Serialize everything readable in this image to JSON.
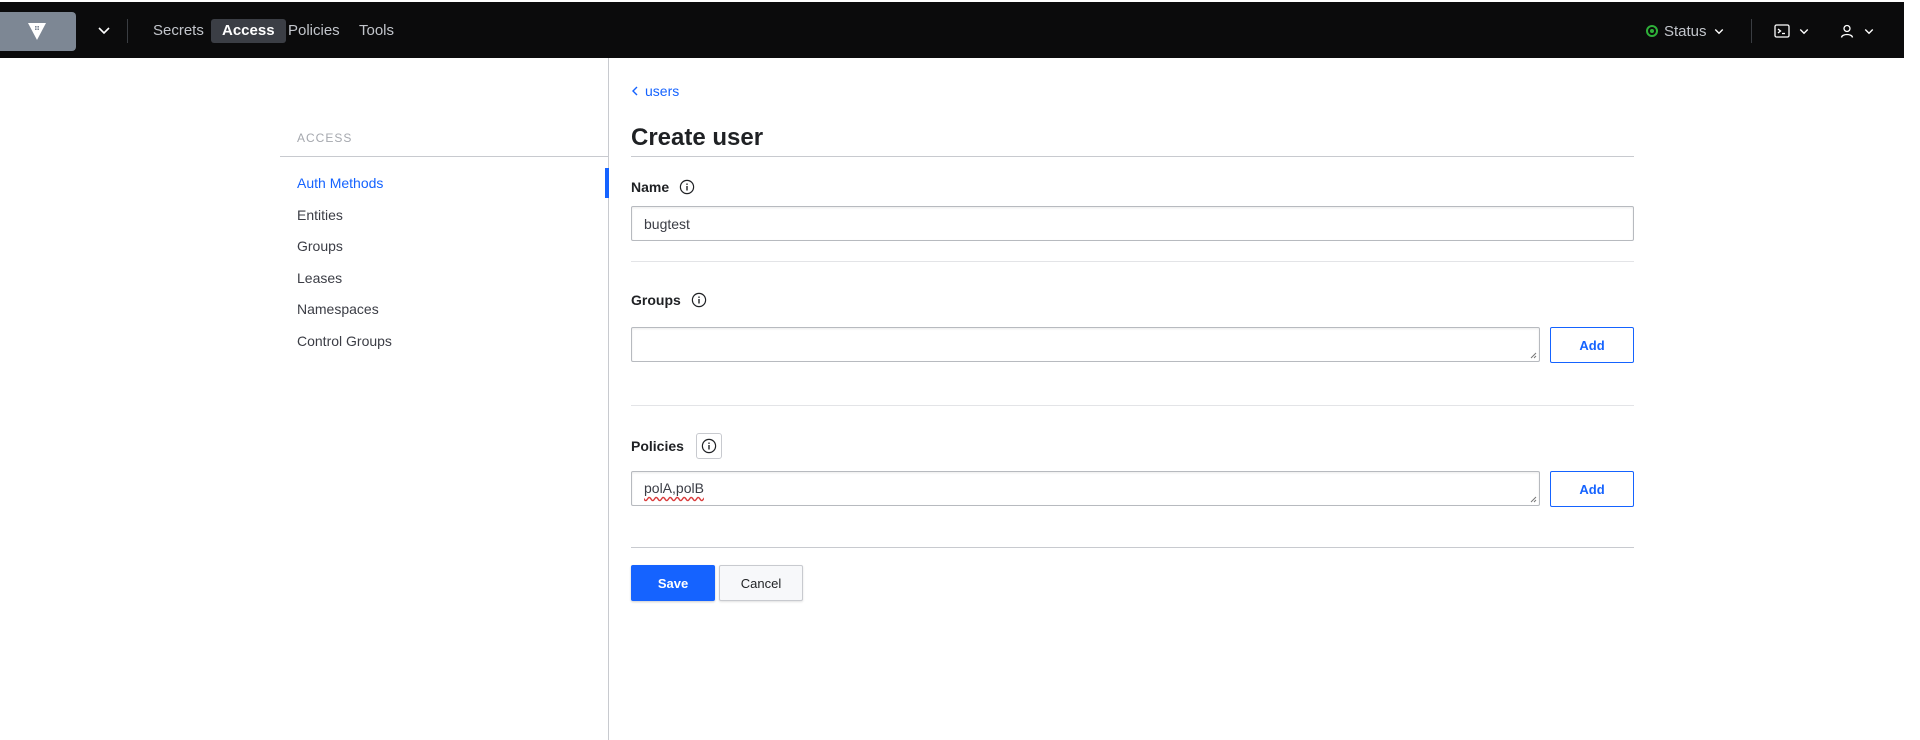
{
  "nav": {
    "links": [
      "Secrets",
      "Access",
      "Policies",
      "Tools"
    ],
    "active": "Access",
    "status_label": "Status",
    "status_color": "#2eb039",
    "logo_icon": "vault-logo-icon",
    "console_icon": "terminal-icon",
    "user_icon": "user-icon"
  },
  "sidebar": {
    "title": "ACCESS",
    "items": [
      "Auth Methods",
      "Entities",
      "Groups",
      "Leases",
      "Namespaces",
      "Control Groups"
    ],
    "active": "Auth Methods"
  },
  "main": {
    "breadcrumb": "users",
    "title": "Create user",
    "name": {
      "label": "Name",
      "value": "bugtest"
    },
    "groups": {
      "label": "Groups",
      "value": "",
      "add_label": "Add"
    },
    "policies": {
      "label": "Policies",
      "value": "polA,polB",
      "add_label": "Add"
    },
    "save_label": "Save",
    "cancel_label": "Cancel"
  },
  "colors": {
    "accent": "#1563ff",
    "nav_bg": "#0b0b0c"
  }
}
